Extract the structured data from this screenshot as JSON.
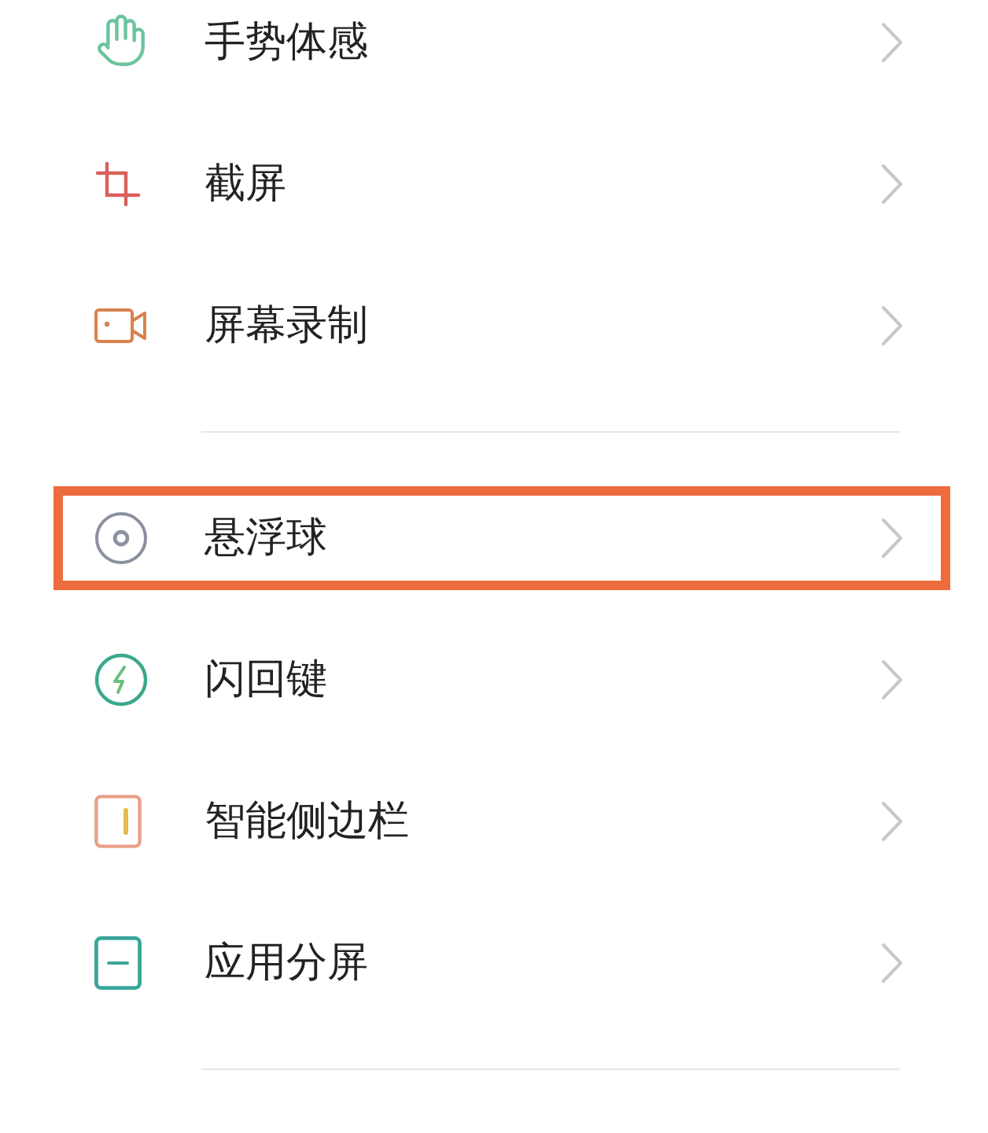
{
  "groups": [
    {
      "items": [
        {
          "label": "手势体感",
          "highlighted": false
        },
        {
          "label": "截屏",
          "highlighted": false
        },
        {
          "label": "屏幕录制",
          "highlighted": false
        }
      ]
    },
    {
      "items": [
        {
          "label": "悬浮球",
          "highlighted": true
        },
        {
          "label": "闪回键",
          "highlighted": false
        },
        {
          "label": "智能侧边栏",
          "highlighted": false
        },
        {
          "label": "应用分屏",
          "highlighted": false
        }
      ]
    }
  ]
}
